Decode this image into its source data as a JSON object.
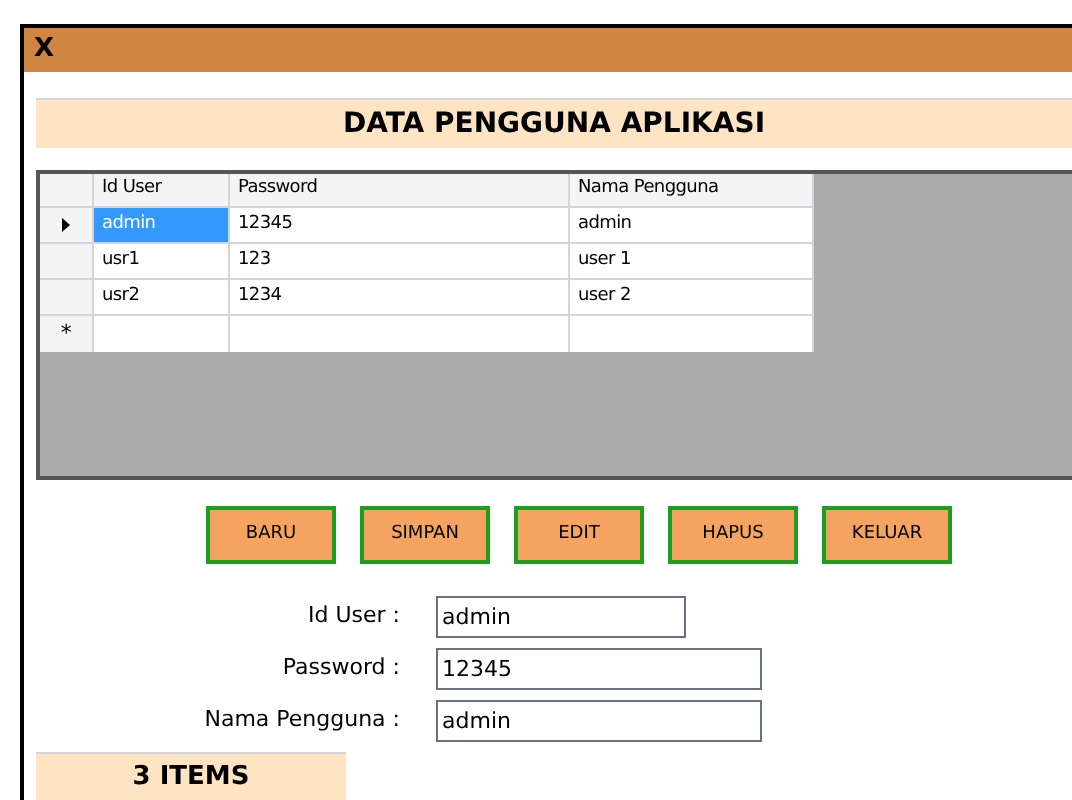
{
  "window": {
    "title": "X"
  },
  "header": "DATA PENGGUNA APLIKASI",
  "table": {
    "columns": [
      "Id User",
      "Password",
      "Nama Pengguna"
    ],
    "rows": [
      {
        "cells": [
          "admin",
          "12345",
          "admin"
        ],
        "selected": true
      },
      {
        "cells": [
          "usr1",
          "123",
          "user 1"
        ],
        "selected": false
      },
      {
        "cells": [
          "usr2",
          "1234",
          "user 2"
        ],
        "selected": false
      }
    ],
    "new_row_marker": "*"
  },
  "buttons": [
    "BARU",
    "SIMPAN",
    "EDIT",
    "HAPUS",
    "KELUAR"
  ],
  "fields": [
    {
      "label": "Id User :",
      "value": "admin"
    },
    {
      "label": "Password :",
      "value": "12345"
    },
    {
      "label": "Nama Pengguna :",
      "value": "admin"
    }
  ],
  "status": "3 ITEMS"
}
